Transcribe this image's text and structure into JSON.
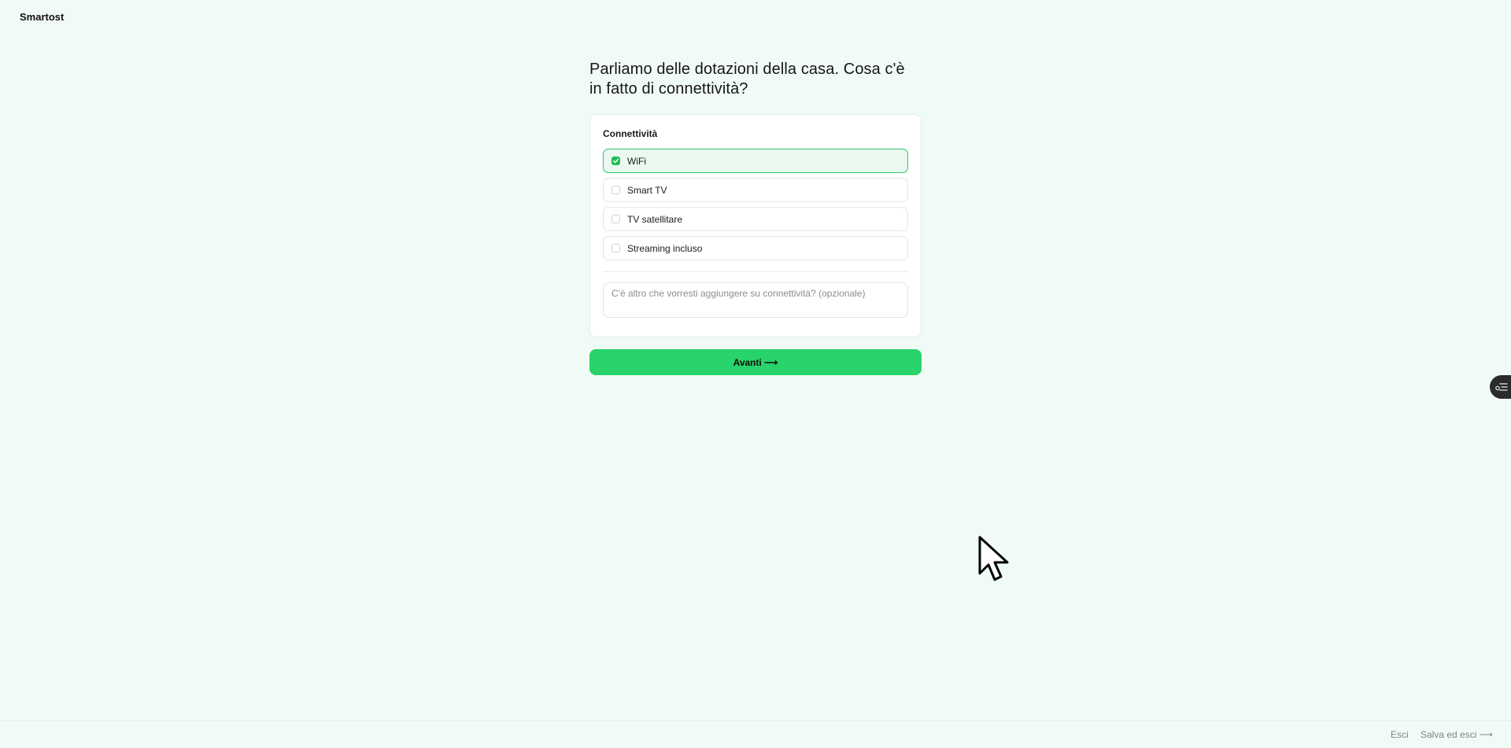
{
  "app": {
    "brand": "Smartost"
  },
  "question": {
    "title": "Parliamo delle dotazioni della casa. Cosa c'è in fatto di connettività?"
  },
  "card": {
    "section_title": "Connettività",
    "options": [
      {
        "label": "WiFi",
        "checked": true
      },
      {
        "label": "Smart TV",
        "checked": false
      },
      {
        "label": "TV satellitare",
        "checked": false
      },
      {
        "label": "Streaming incluso",
        "checked": false
      }
    ],
    "notes": {
      "value": "",
      "placeholder": "C'è altro che vorresti aggiungere su connettività? (opzionale)"
    }
  },
  "next_button": {
    "label": "Avanti ⟶"
  },
  "side_widget": {
    "icon": "list-settings-icon"
  },
  "footer": {
    "exit_label": "Esci",
    "save_exit_label": "Salva ed esci ⟶"
  },
  "colors": {
    "background": "#f1fbf6",
    "accent": "#27d36a",
    "checked_fill": "#1fbf55",
    "checked_row_bg": "#e9f9ef"
  }
}
